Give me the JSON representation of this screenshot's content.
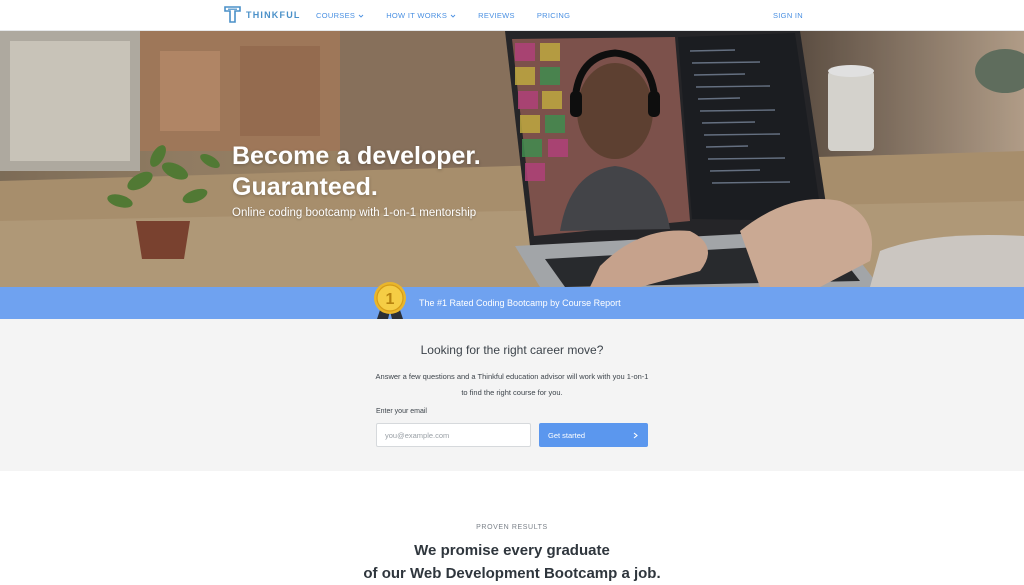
{
  "nav": {
    "logo_text": "THINKFUL",
    "links": [
      {
        "label": "COURSES",
        "dropdown": true
      },
      {
        "label": "HOW IT WORKS",
        "dropdown": true
      },
      {
        "label": "REVIEWS",
        "dropdown": false
      },
      {
        "label": "PRICING",
        "dropdown": false
      }
    ],
    "signin_label": "SIGN IN"
  },
  "hero": {
    "title_line1": "Become a developer.",
    "title_line2": "Guaranteed.",
    "subtitle": "Online coding bootcamp with 1-on-1 mentorship"
  },
  "rating_band": {
    "text": "The #1 Rated Coding Bootcamp by Course Report",
    "medal_number": "1"
  },
  "form": {
    "title": "Looking for the right career move?",
    "description": "Answer a few questions and a Thinkful education advisor will work with you 1-on-1 to find the right course for you.",
    "email_label": "Enter your email",
    "email_placeholder": "you@example.com",
    "email_value": "",
    "submit_label": "Get started"
  },
  "results": {
    "label": "PROVEN RESULTS",
    "title_line1": "We promise every graduate",
    "title_line2": "of our Web Development Bootcamp a job."
  },
  "colors": {
    "brand_blue": "#4a90e2",
    "band_blue": "#6fa2f0",
    "button_blue": "#5b97ee",
    "form_bg": "#f4f4f4"
  },
  "icons": {
    "logo": "thinkful-logo-icon",
    "dropdown": "chevron-down-icon",
    "medal": "medal-icon",
    "submit_arrow": "chevron-right-icon"
  }
}
